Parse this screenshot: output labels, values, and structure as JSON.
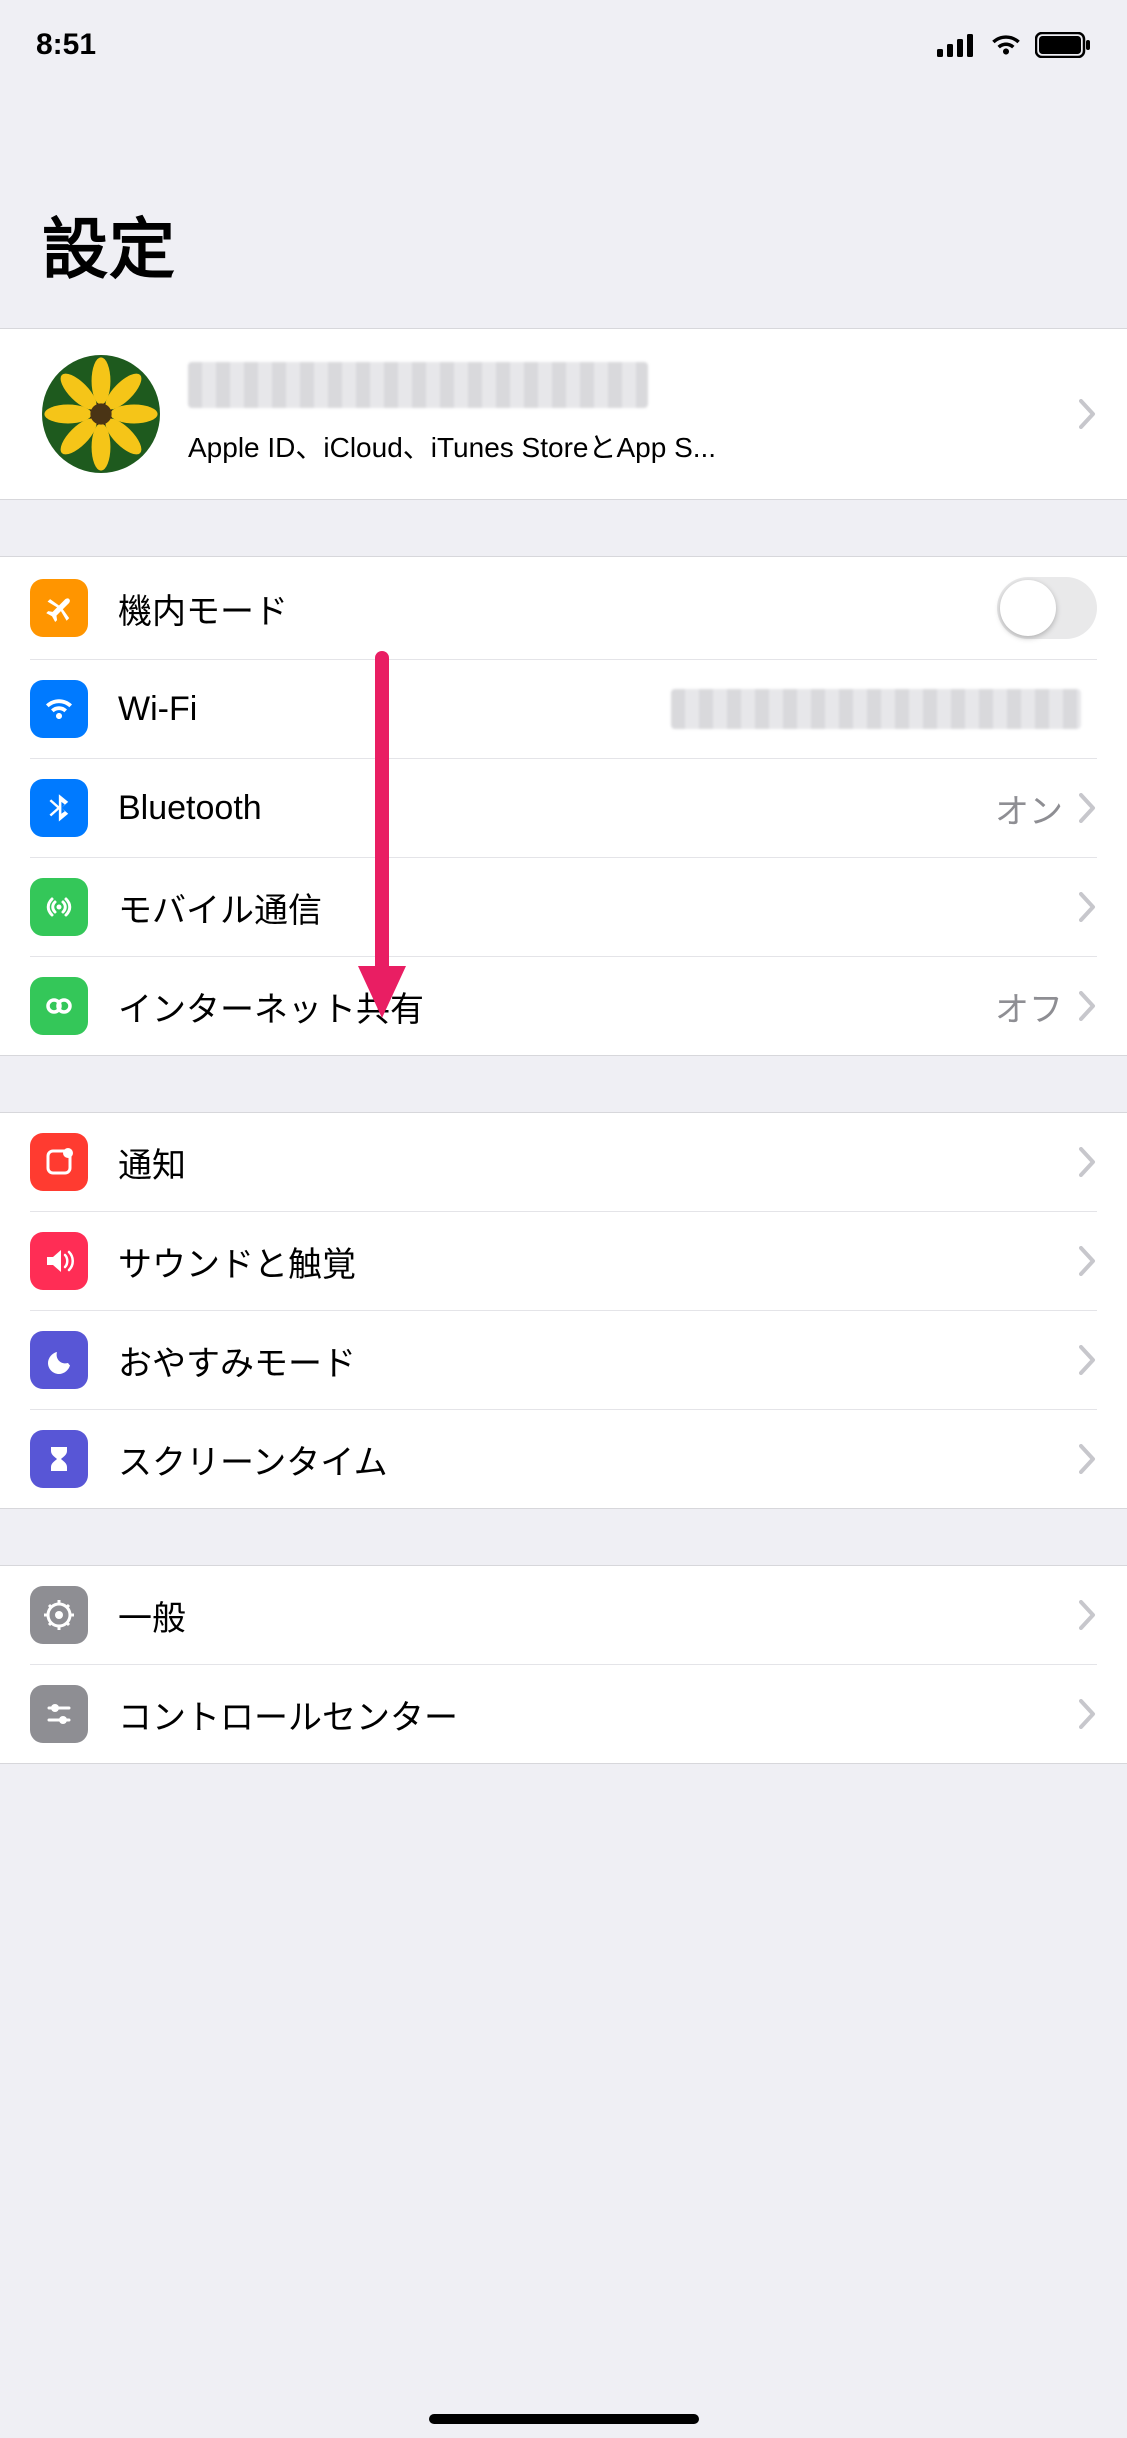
{
  "status": {
    "time": "8:51"
  },
  "page": {
    "title": "設定"
  },
  "profile": {
    "name_redacted": true,
    "subtitle": "Apple ID、iCloud、iTunes StoreとApp S..."
  },
  "groups": [
    {
      "id": "connectivity",
      "items": [
        {
          "id": "airplane",
          "label": "機内モード",
          "color": "c-orange",
          "control": "toggle",
          "toggle_on": false
        },
        {
          "id": "wifi",
          "label": "Wi-Fi",
          "color": "c-blue",
          "control": "disclosure",
          "value_redacted": true
        },
        {
          "id": "bluetooth",
          "label": "Bluetooth",
          "color": "c-btblue",
          "control": "disclosure",
          "value": "オン"
        },
        {
          "id": "cellular",
          "label": "モバイル通信",
          "color": "c-green",
          "control": "disclosure"
        },
        {
          "id": "hotspot",
          "label": "インターネット共有",
          "color": "c-green2",
          "control": "disclosure",
          "value": "オフ"
        }
      ]
    },
    {
      "id": "notifications",
      "items": [
        {
          "id": "notifications",
          "label": "通知",
          "color": "c-red",
          "control": "disclosure"
        },
        {
          "id": "sounds",
          "label": "サウンドと触覚",
          "color": "c-pink",
          "control": "disclosure"
        },
        {
          "id": "dnd",
          "label": "おやすみモード",
          "color": "c-purple",
          "control": "disclosure"
        },
        {
          "id": "screentime",
          "label": "スクリーンタイム",
          "color": "c-purple2",
          "control": "disclosure"
        }
      ]
    },
    {
      "id": "general",
      "items": [
        {
          "id": "general",
          "label": "一般",
          "color": "c-grey",
          "control": "disclosure"
        },
        {
          "id": "controlcenter",
          "label": "コントロールセンター",
          "color": "c-grey",
          "control": "disclosure"
        }
      ]
    }
  ],
  "annotation": {
    "arrow_color": "#e91e63"
  }
}
